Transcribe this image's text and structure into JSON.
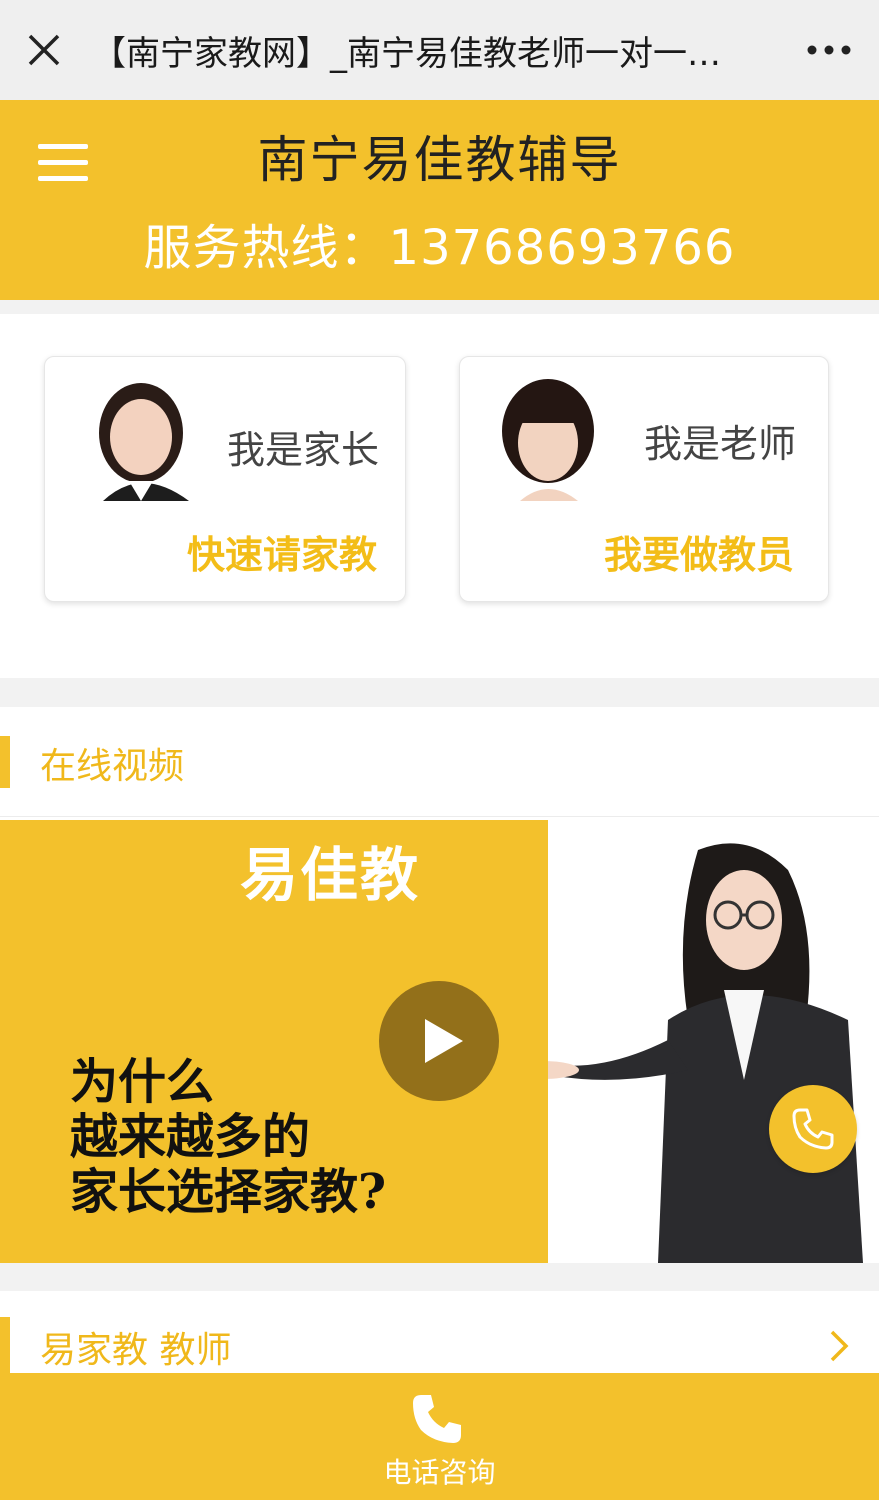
{
  "browser": {
    "title": "【南宁家教网】_南宁易佳教老师一对一…"
  },
  "header": {
    "site_title": "南宁易佳教辅导",
    "hotline": "服务热线：13768693766"
  },
  "roles": [
    {
      "label": "我是家长",
      "action": "快速请家教"
    },
    {
      "label": "我是老师",
      "action": "我要做教员"
    }
  ],
  "video_section": {
    "title": "在线视频",
    "brand": "易佳教",
    "question_lines": [
      "为什么",
      "越来越多的",
      "家长选择家教?"
    ]
  },
  "teacher_section": {
    "title": "易家教 教师"
  },
  "bottom_bar": {
    "label": "电话咨询"
  },
  "colors": {
    "accent": "#f3c12c",
    "accent_text": "#f0b81b"
  }
}
